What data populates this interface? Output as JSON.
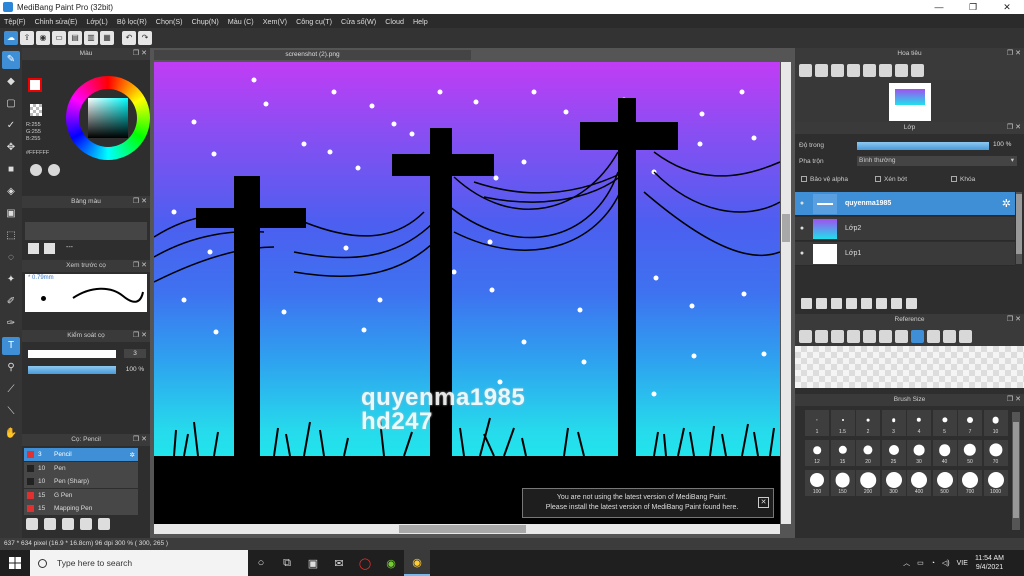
{
  "window": {
    "title": "MediBang Paint Pro (32bit)",
    "controls": [
      "—",
      "❐",
      "✕"
    ]
  },
  "menu": [
    "Tệp(F)",
    "Chỉnh sửa(E)",
    "Lớp(L)",
    "Bộ lọc(R)",
    "Chọn(S)",
    "Chụp(N)",
    "Màu (C)",
    "Xem(V)",
    "Công cụ(T)",
    "Cửa số(W)",
    "Cloud",
    "Help"
  ],
  "color_panel": {
    "title": "Màu",
    "r": "R:255",
    "g": "G:255",
    "b": "B:255",
    "hex": "#FFFFFF"
  },
  "palette_panel": {
    "title": "Bảng màu",
    "dash": "---"
  },
  "preview_panel": {
    "title": "Xem trước cọ",
    "size": "* 0.79mm"
  },
  "control_panel": {
    "title": "Kiểm soát cọ",
    "size_value": "3",
    "opacity_value": "100 %"
  },
  "brush_panel": {
    "title": "Cọ: Pencil",
    "items": [
      {
        "size": "3",
        "name": "Pencil",
        "color": "#e03030",
        "selected": true
      },
      {
        "size": "10",
        "name": "Pen",
        "color": "#222222",
        "selected": false
      },
      {
        "size": "10",
        "name": "Pen (Sharp)",
        "color": "#222222",
        "selected": false
      },
      {
        "size": "15",
        "name": "G Pen",
        "color": "#e03030",
        "selected": false
      },
      {
        "size": "15",
        "name": "Mapping Pen",
        "color": "#e03030",
        "selected": false
      }
    ]
  },
  "canvas": {
    "tab": "screenshot (2).png",
    "watermark_line1": "quyenma1985",
    "watermark_line2": "hd247"
  },
  "notice": {
    "line1": "You are not using the latest version of MediBang Paint.",
    "line2": "Please install the latest version of MediBang Paint found here.",
    "close": "✕"
  },
  "navigator": {
    "title": "Hoa tiêu"
  },
  "layer_panel": {
    "title": "Lớp",
    "opacity_label": "Độ trong",
    "opacity_value": "100 %",
    "blend_label": "Pha trộn",
    "blend_value": "Bình thường",
    "protect_alpha": "Bảo vệ alpha",
    "clipping": "Xén bớt",
    "lock": "Khóa",
    "layers": [
      {
        "name": "quyenma1985",
        "selected": true
      },
      {
        "name": "Lớp2",
        "selected": false
      },
      {
        "name": "Lớp1",
        "selected": false
      }
    ]
  },
  "reference_panel": {
    "title": "Reference"
  },
  "brush_size_panel": {
    "title": "Brush Size",
    "sizes": [
      "1",
      "1.5",
      "2",
      "3",
      "4",
      "5",
      "7",
      "10",
      "12",
      "15",
      "20",
      "25",
      "30",
      "40",
      "50",
      "70",
      "100",
      "150",
      "200",
      "300",
      "400",
      "500",
      "700",
      "1000"
    ]
  },
  "status": {
    "text": "637 * 634 pixel  (16.9 * 16.8cm)  96 dpi  300 %  ( 300, 265 )"
  },
  "taskbar": {
    "search_placeholder": "Type here to search",
    "lang": "VIE",
    "time": "11:54 AM",
    "date": "9/4/2021"
  }
}
